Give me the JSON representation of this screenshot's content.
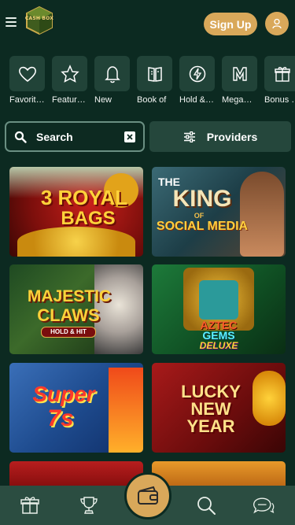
{
  "header": {
    "logo_text": "CASH BOX",
    "signup_label": "Sign Up"
  },
  "categories": [
    {
      "label": "Favorit…",
      "icon": "heart-icon"
    },
    {
      "label": "Featur…",
      "icon": "star-icon"
    },
    {
      "label": "New",
      "icon": "bell-icon"
    },
    {
      "label": "Book of",
      "icon": "book-icon"
    },
    {
      "label": "Hold &…",
      "icon": "lightning-icon"
    },
    {
      "label": "Mega…",
      "icon": "mega-icon"
    },
    {
      "label": "Bonus …",
      "icon": "gift-icon"
    }
  ],
  "search": {
    "placeholder": "Search"
  },
  "providers": {
    "label": "Providers"
  },
  "games": [
    {
      "line1": "3 ROYAL",
      "line2": "BAGS",
      "line3": ""
    },
    {
      "line1": "THE",
      "line2": "KING",
      "line3": "SOCIAL MEDIA",
      "small": "OF"
    },
    {
      "line1": "MAJESTIC",
      "line2": "CLAWS",
      "line3": "HOLD & HIT"
    },
    {
      "line1": "AZTEC",
      "line2": "GEMS",
      "line3": "DELUXE"
    },
    {
      "line1": "Super",
      "line2": "7s",
      "line3": ""
    },
    {
      "line1": "LUCKY",
      "line2": "NEW",
      "line3": "YEAR"
    }
  ],
  "colors": {
    "background": "#0c2a21",
    "accent": "#d9a85a",
    "tile_box": "#214338",
    "nav": "#2b4d41"
  }
}
